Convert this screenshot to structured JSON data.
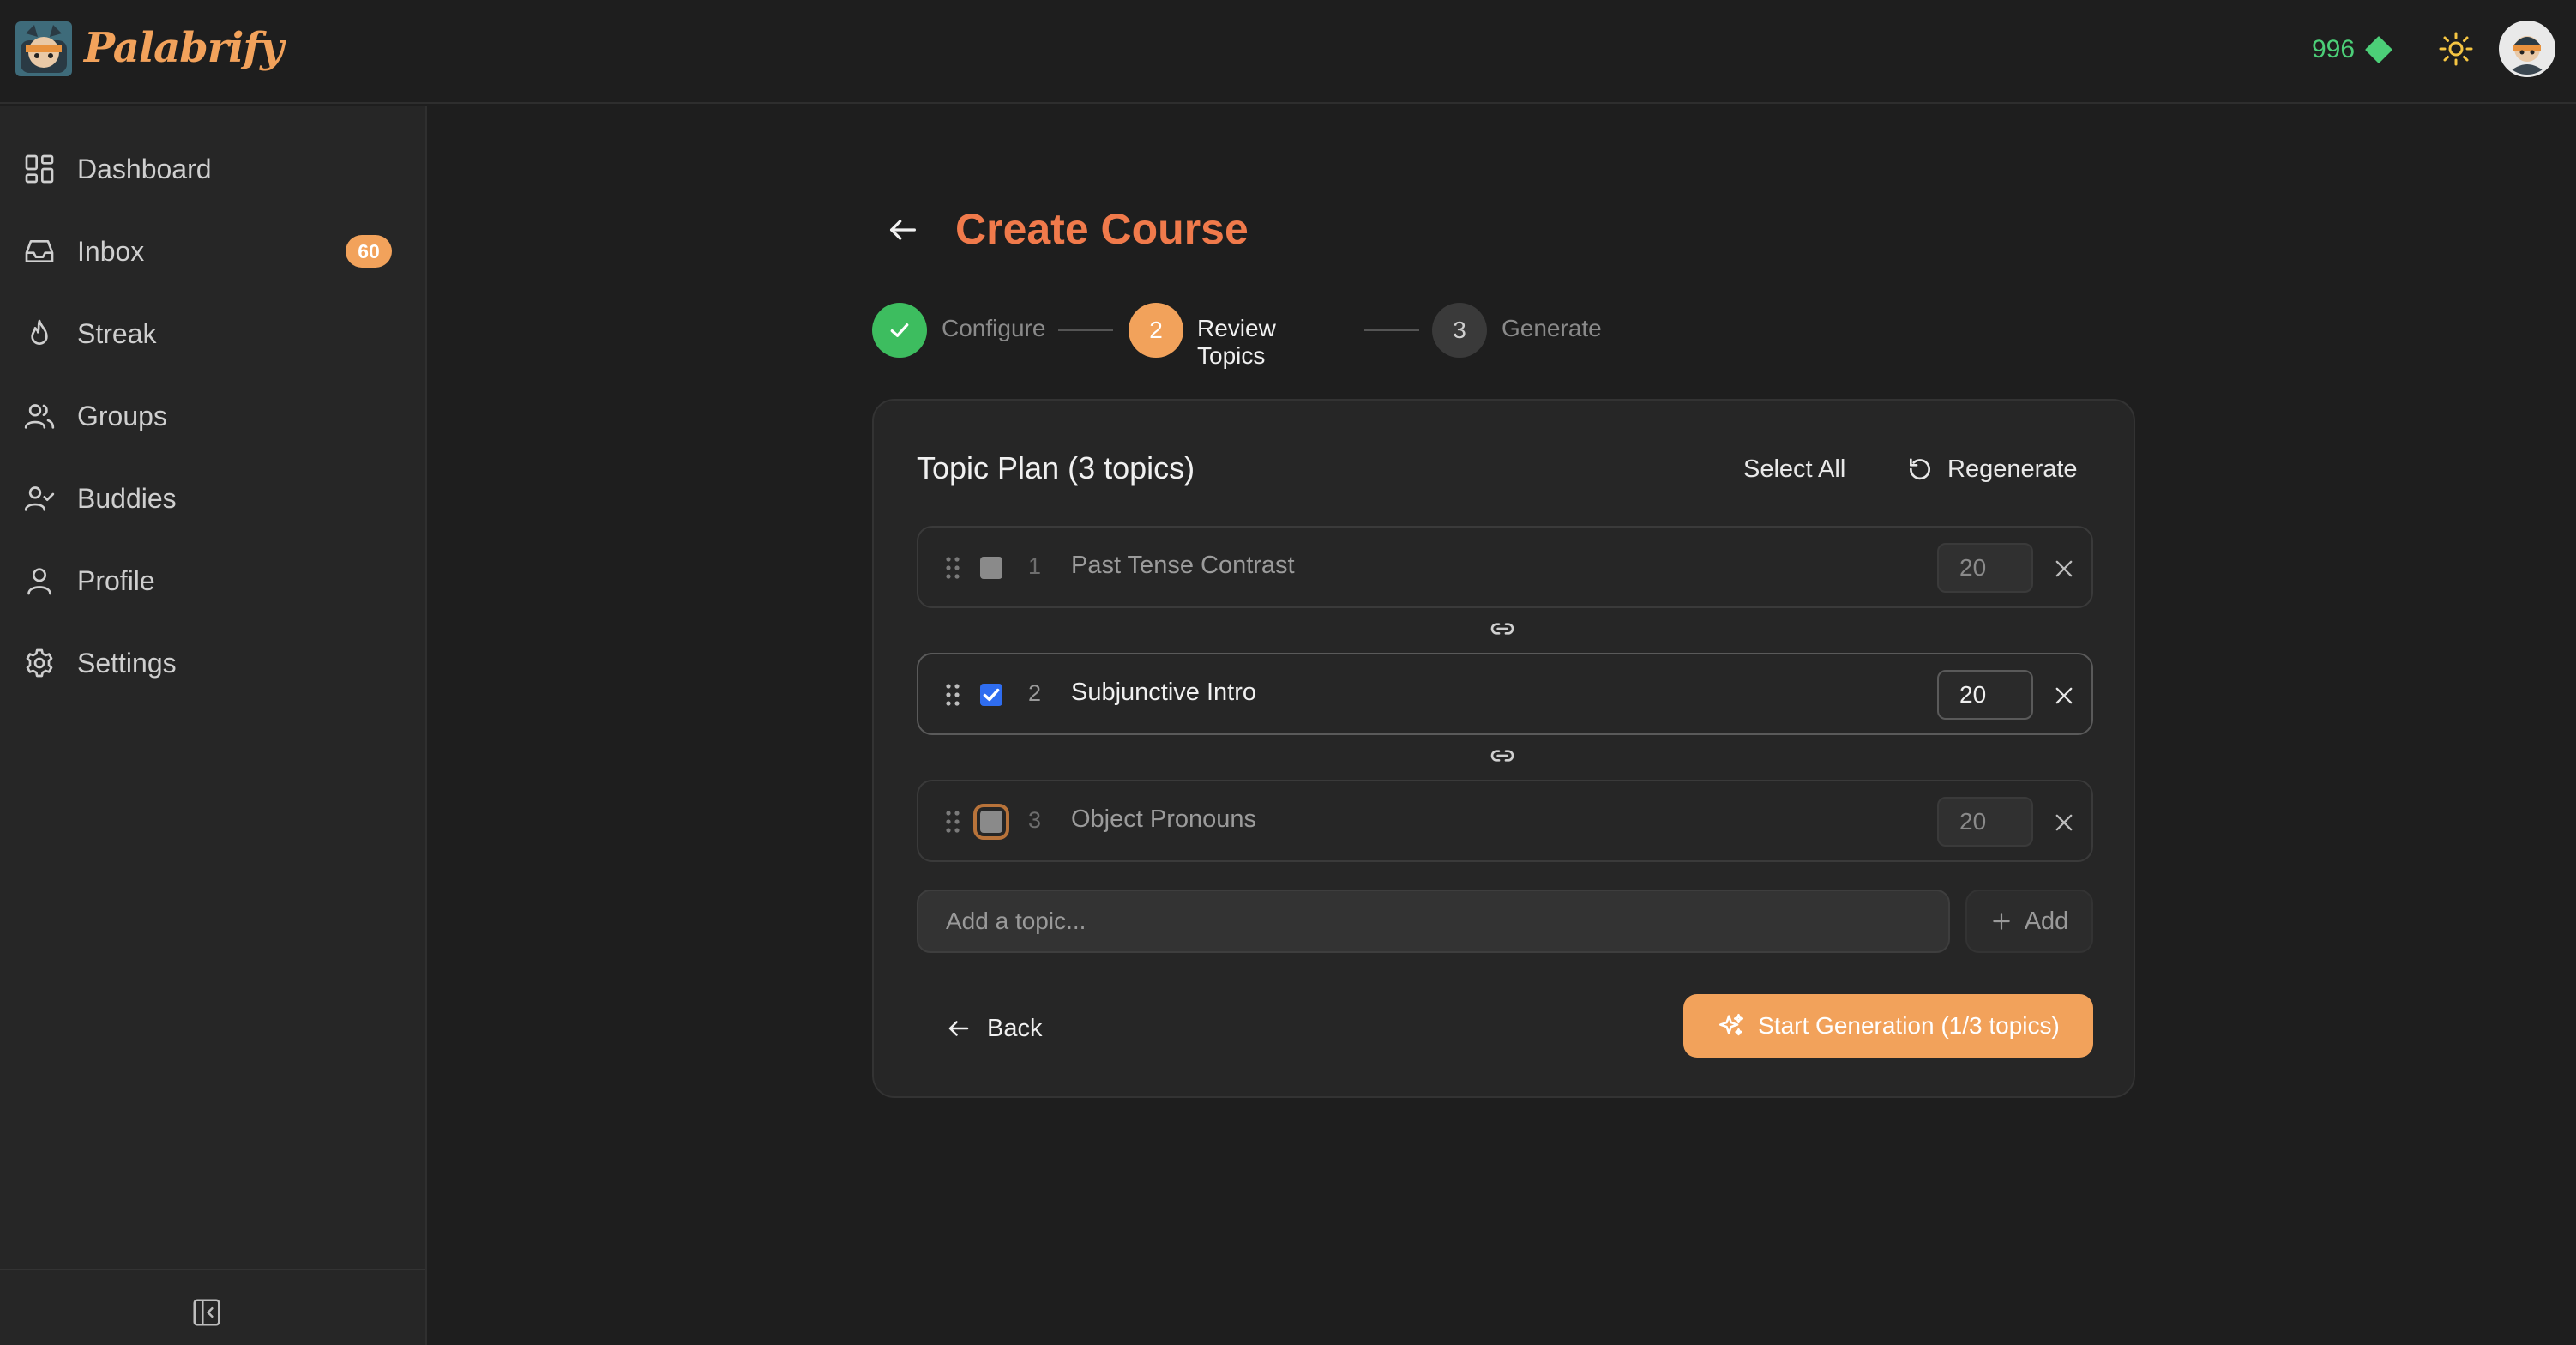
{
  "app": {
    "brand": "Palabrify",
    "gem_count": "996",
    "colors": {
      "accent": "#f2a25b",
      "title": "#f07a4b",
      "success": "#3dbd5f",
      "gem": "#4ccf78"
    }
  },
  "sidebar": {
    "items": [
      {
        "label": "Dashboard",
        "icon": "dashboard-icon"
      },
      {
        "label": "Inbox",
        "icon": "inbox-icon",
        "badge": "60"
      },
      {
        "label": "Streak",
        "icon": "flame-icon"
      },
      {
        "label": "Groups",
        "icon": "users-icon"
      },
      {
        "label": "Buddies",
        "icon": "user-check-icon"
      },
      {
        "label": "Profile",
        "icon": "user-icon"
      },
      {
        "label": "Settings",
        "icon": "gear-icon"
      }
    ]
  },
  "page": {
    "title": "Create Course"
  },
  "stepper": {
    "steps": [
      {
        "number": "1",
        "label": "Configure",
        "state": "done"
      },
      {
        "number": "2",
        "label": "Review Topics",
        "state": "current"
      },
      {
        "number": "3",
        "label": "Generate",
        "state": "upcoming"
      }
    ]
  },
  "plan": {
    "title": "Topic Plan (3 topics)",
    "select_all": "Select All",
    "regenerate": "Regenerate",
    "topics": [
      {
        "index": "1",
        "name": "Past Tense Contrast",
        "qty": "20",
        "checked": false
      },
      {
        "index": "2",
        "name": "Subjunctive Intro",
        "qty": "20",
        "checked": true
      },
      {
        "index": "3",
        "name": "Object Pronouns",
        "qty": "20",
        "checked": false
      }
    ],
    "add_placeholder": "Add a topic...",
    "add_label": "Add",
    "back_label": "Back",
    "start_label": "Start Generation (1/3 topics)"
  }
}
